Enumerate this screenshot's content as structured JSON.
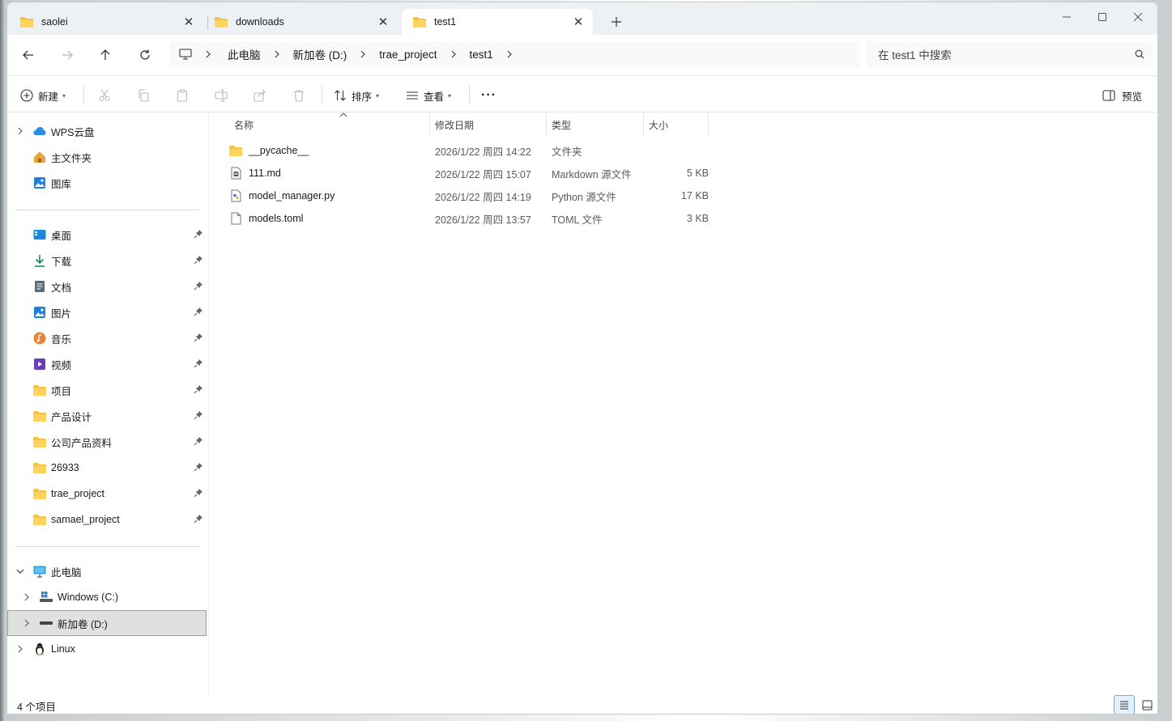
{
  "tabs": [
    {
      "label": "saolei",
      "active": false
    },
    {
      "label": "downloads",
      "active": false
    },
    {
      "label": "test1",
      "active": true
    }
  ],
  "window_controls": {
    "minimize": "—",
    "maximize": "☐",
    "close": "✕"
  },
  "address": {
    "crumbs": [
      "此电脑",
      "新加卷 (D:)",
      "trae_project",
      "test1"
    ]
  },
  "search": {
    "placeholder": "在 test1 中搜索"
  },
  "toolbar": {
    "new_label": "新建",
    "sort_label": "排序",
    "view_label": "查看",
    "more_label": "···",
    "preview_label": "预览"
  },
  "sidebar": {
    "top_items": [
      {
        "label": "WPS云盘",
        "icon": "cloud-icon",
        "expandable": true
      },
      {
        "label": "主文件夹",
        "icon": "home-icon",
        "expandable": false
      },
      {
        "label": "图库",
        "icon": "gallery-icon",
        "expandable": false
      }
    ],
    "pinned_items": [
      {
        "label": "桌面",
        "icon": "desktop-icon"
      },
      {
        "label": "下载",
        "icon": "download-icon"
      },
      {
        "label": "文档",
        "icon": "document-icon"
      },
      {
        "label": "图片",
        "icon": "pictures-icon"
      },
      {
        "label": "音乐",
        "icon": "music-icon"
      },
      {
        "label": "视频",
        "icon": "video-icon"
      },
      {
        "label": "项目",
        "icon": "folder-icon"
      },
      {
        "label": "产品设计",
        "icon": "folder-icon"
      },
      {
        "label": "公司产品资料",
        "icon": "folder-icon"
      },
      {
        "label": "26933",
        "icon": "folder-icon"
      },
      {
        "label": "trae_project",
        "icon": "folder-icon"
      },
      {
        "label": "samael_project",
        "icon": "folder-icon"
      }
    ],
    "this_pc": {
      "label": "此电脑",
      "icon": "computer-icon"
    },
    "drives": [
      {
        "label": "Windows (C:)",
        "icon": "windows-drive-icon",
        "selected": false
      },
      {
        "label": "新加卷 (D:)",
        "icon": "drive-icon",
        "selected": true
      }
    ],
    "linux": {
      "label": "Linux",
      "icon": "linux-icon"
    }
  },
  "columns": {
    "name": "名称",
    "modified": "修改日期",
    "type": "类型",
    "size": "大小"
  },
  "files": [
    {
      "name": "__pycache__",
      "modified": "2026/1/22 周四 14:22",
      "type": "文件夹",
      "size": "",
      "icon": "folder-icon"
    },
    {
      "name": "111.md",
      "modified": "2026/1/22 周四 15:07",
      "type": "Markdown 源文件",
      "size": "5 KB",
      "icon": "markdown-file-icon"
    },
    {
      "name": "model_manager.py",
      "modified": "2026/1/22 周四 14:19",
      "type": "Python 源文件",
      "size": "17 KB",
      "icon": "python-file-icon"
    },
    {
      "name": "models.toml",
      "modified": "2026/1/22 周四 13:57",
      "type": "TOML 文件",
      "size": "3 KB",
      "icon": "file-icon"
    }
  ],
  "status": {
    "item_count": "4 个项目"
  },
  "colors": {
    "folder": "#f5c242",
    "accent": "#0067c0",
    "selected_bg": "#e0e0e0"
  }
}
